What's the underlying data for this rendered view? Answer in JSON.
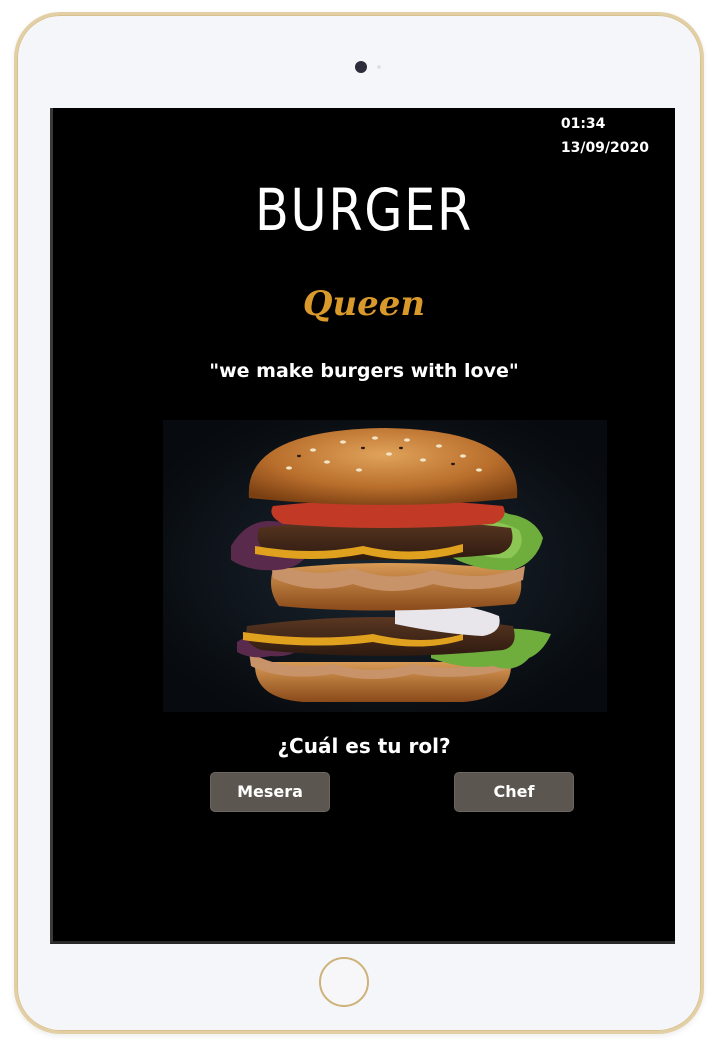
{
  "status": {
    "time": "01:34",
    "date": "13/09/2020"
  },
  "brand": {
    "title": "BURGER",
    "subtitle": "Queen",
    "slogan": "\"we make burgers with love\""
  },
  "hero_image": {
    "icon": "burger-photo"
  },
  "role_selection": {
    "question": "¿Cuál es tu rol?",
    "buttons": [
      {
        "label": "Mesera"
      },
      {
        "label": "Chef"
      }
    ]
  },
  "colors": {
    "background": "#000000",
    "accent": "#d99a2b",
    "button": "#5c5650",
    "device_frame": "#e3cfa4"
  }
}
